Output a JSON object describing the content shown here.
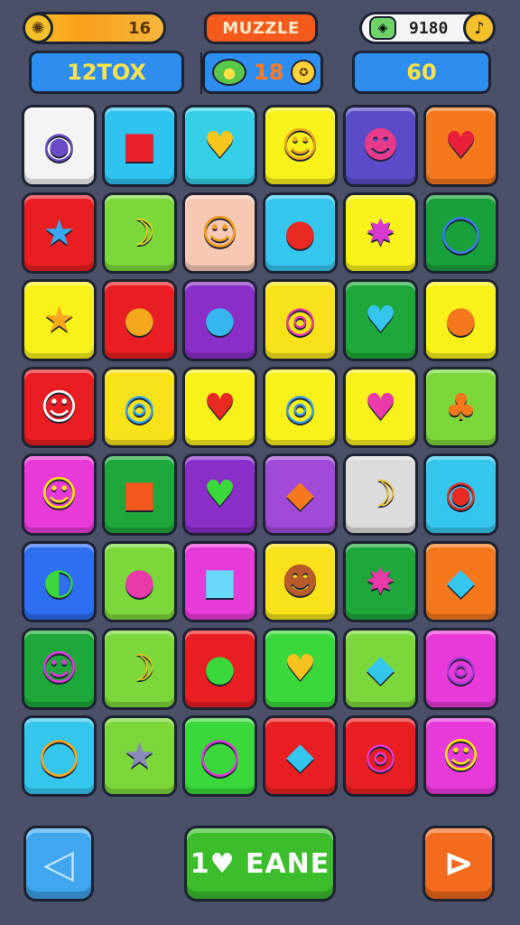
{
  "header": {
    "coins_value": "16",
    "title": "MUZZLE",
    "timer_value": "9180",
    "score_label": "12TOX",
    "moves_value": "18",
    "target_value": "60"
  },
  "icons": {
    "coin": "hedgehog-coin-icon",
    "gem": "gem-icon",
    "clock": "music-note-icon",
    "apple": "apple-icon",
    "medal": "medal-icon"
  },
  "board": {
    "rows": 8,
    "cols": 6,
    "tiles": [
      {
        "color": "#f4f4f4",
        "icon": "ring-icon",
        "glyph": "◉",
        "glyph_color": "#6a4cc8"
      },
      {
        "color": "#2fc3f0",
        "icon": "cube-icon",
        "glyph": "■",
        "glyph_color": "#e8202a"
      },
      {
        "color": "#35d0e8",
        "icon": "heart-icon",
        "glyph": "♥",
        "glyph_color": "#f7c61c"
      },
      {
        "color": "#f8f21a",
        "icon": "smiley-icon",
        "glyph": "☺",
        "glyph_color": "#f0a81c"
      },
      {
        "color": "#5a4cc8",
        "icon": "face-icon",
        "glyph": "☻",
        "glyph_color": "#e83a8a"
      },
      {
        "color": "#f5781c",
        "icon": "heart-icon",
        "glyph": "♥",
        "glyph_color": "#e8203a"
      },
      {
        "color": "#e81e22",
        "icon": "star-icon",
        "glyph": "★",
        "glyph_color": "#3aa8f0"
      },
      {
        "color": "#7cd83a",
        "icon": "banana-icon",
        "glyph": "☽",
        "glyph_color": "#f8d21c"
      },
      {
        "color": "#f7c8b4",
        "icon": "smiley-icon",
        "glyph": "☺",
        "glyph_color": "#f59a1c"
      },
      {
        "color": "#35c6ee",
        "icon": "tomato-icon",
        "glyph": "●",
        "glyph_color": "#e82a22"
      },
      {
        "color": "#f8f21a",
        "icon": "splat-icon",
        "glyph": "✸",
        "glyph_color": "#d83ad0"
      },
      {
        "color": "#18a03a",
        "icon": "ring-icon",
        "glyph": "◯",
        "glyph_color": "#3a7ee8"
      },
      {
        "color": "#f8f21a",
        "icon": "star-face-icon",
        "glyph": "★",
        "glyph_color": "#f5a81c"
      },
      {
        "color": "#e81e22",
        "icon": "bean-icon",
        "glyph": "●",
        "glyph_color": "#f5a81c"
      },
      {
        "color": "#8a2ec8",
        "icon": "apple-icon",
        "glyph": "●",
        "glyph_color": "#35b6ee"
      },
      {
        "color": "#f8e21a",
        "icon": "donut-icon",
        "glyph": "◎",
        "glyph_color": "#e83aa8"
      },
      {
        "color": "#1ea83a",
        "icon": "heart-icon",
        "glyph": "♥",
        "glyph_color": "#35c6ee"
      },
      {
        "color": "#f8f21a",
        "icon": "ball-icon",
        "glyph": "●",
        "glyph_color": "#f5781c"
      },
      {
        "color": "#e81e22",
        "icon": "face-icon",
        "glyph": "☺",
        "glyph_color": "#ffffff"
      },
      {
        "color": "#f8e21a",
        "icon": "donut-icon",
        "glyph": "◎",
        "glyph_color": "#2fa8f0"
      },
      {
        "color": "#f8f21a",
        "icon": "strawberry-icon",
        "glyph": "♥",
        "glyph_color": "#e82a22"
      },
      {
        "color": "#f8f21a",
        "icon": "ring-icon",
        "glyph": "◎",
        "glyph_color": "#3a9ef0"
      },
      {
        "color": "#f8f21a",
        "icon": "heart-icon",
        "glyph": "♥",
        "glyph_color": "#e83aa8"
      },
      {
        "color": "#7cd83a",
        "icon": "palm-tree-icon",
        "glyph": "♣",
        "glyph_color": "#f5781c"
      },
      {
        "color": "#e83ad8",
        "icon": "smiley-icon",
        "glyph": "☺",
        "glyph_color": "#f8e21a"
      },
      {
        "color": "#1ea83a",
        "icon": "cube-icon",
        "glyph": "■",
        "glyph_color": "#f5581c"
      },
      {
        "color": "#8a2ec8",
        "icon": "apple-icon",
        "glyph": "♥",
        "glyph_color": "#3ad83a"
      },
      {
        "color": "#a04ad8",
        "icon": "carrot-icon",
        "glyph": "◆",
        "glyph_color": "#f5781c"
      },
      {
        "color": "#dcdcdc",
        "icon": "banana-icon",
        "glyph": "☽",
        "glyph_color": "#f8c21c"
      },
      {
        "color": "#35c6ee",
        "icon": "donut-icon",
        "glyph": "◉",
        "glyph_color": "#e82a22"
      },
      {
        "color": "#2e6ef0",
        "icon": "watermelon-icon",
        "glyph": "◐",
        "glyph_color": "#3ad83a"
      },
      {
        "color": "#7cd83a",
        "icon": "lollipop-icon",
        "glyph": "●",
        "glyph_color": "#e83aa8"
      },
      {
        "color": "#e83ad8",
        "icon": "cube-icon",
        "glyph": "■",
        "glyph_color": "#6ad8f8"
      },
      {
        "color": "#f8e21a",
        "icon": "face-icon",
        "glyph": "☻",
        "glyph_color": "#b85a2a"
      },
      {
        "color": "#1ea83a",
        "icon": "flower-icon",
        "glyph": "✸",
        "glyph_color": "#e83aa8"
      },
      {
        "color": "#f5781c",
        "icon": "crystal-icon",
        "glyph": "◆",
        "glyph_color": "#35c6ee"
      },
      {
        "color": "#1ea83a",
        "icon": "pig-icon",
        "glyph": "☺",
        "glyph_color": "#d83ad8"
      },
      {
        "color": "#7cd83a",
        "icon": "banana-icon",
        "glyph": "☽",
        "glyph_color": "#f8c21c"
      },
      {
        "color": "#e81e22",
        "icon": "apple-icon",
        "glyph": "●",
        "glyph_color": "#3ad83a"
      },
      {
        "color": "#3ad83a",
        "icon": "heart-icon",
        "glyph": "♥",
        "glyph_color": "#f8c21c"
      },
      {
        "color": "#7cd83a",
        "icon": "crystal-icon",
        "glyph": "◆",
        "glyph_color": "#35c6ee"
      },
      {
        "color": "#e83ad8",
        "icon": "donut-icon",
        "glyph": "◎",
        "glyph_color": "#a83ad8"
      },
      {
        "color": "#35c6ee",
        "icon": "magnifier-icon",
        "glyph": "◯",
        "glyph_color": "#f5a81c"
      },
      {
        "color": "#7cd83a",
        "icon": "star-icon",
        "glyph": "★",
        "glyph_color": "#8a8ab8"
      },
      {
        "color": "#3ad83a",
        "icon": "ring-icon",
        "glyph": "◯",
        "glyph_color": "#d83ad8"
      },
      {
        "color": "#e81e22",
        "icon": "crystal-icon",
        "glyph": "◆",
        "glyph_color": "#35c6ee"
      },
      {
        "color": "#e81e22",
        "icon": "donut-icon",
        "glyph": "◎",
        "glyph_color": "#e83ad8"
      },
      {
        "color": "#e83ad8",
        "icon": "smiley-icon",
        "glyph": "☺",
        "glyph_color": "#f8e21a"
      }
    ]
  },
  "controls": {
    "back_glyph": "◁",
    "play_label": "1♥ EANE",
    "next_glyph": "⊳"
  }
}
